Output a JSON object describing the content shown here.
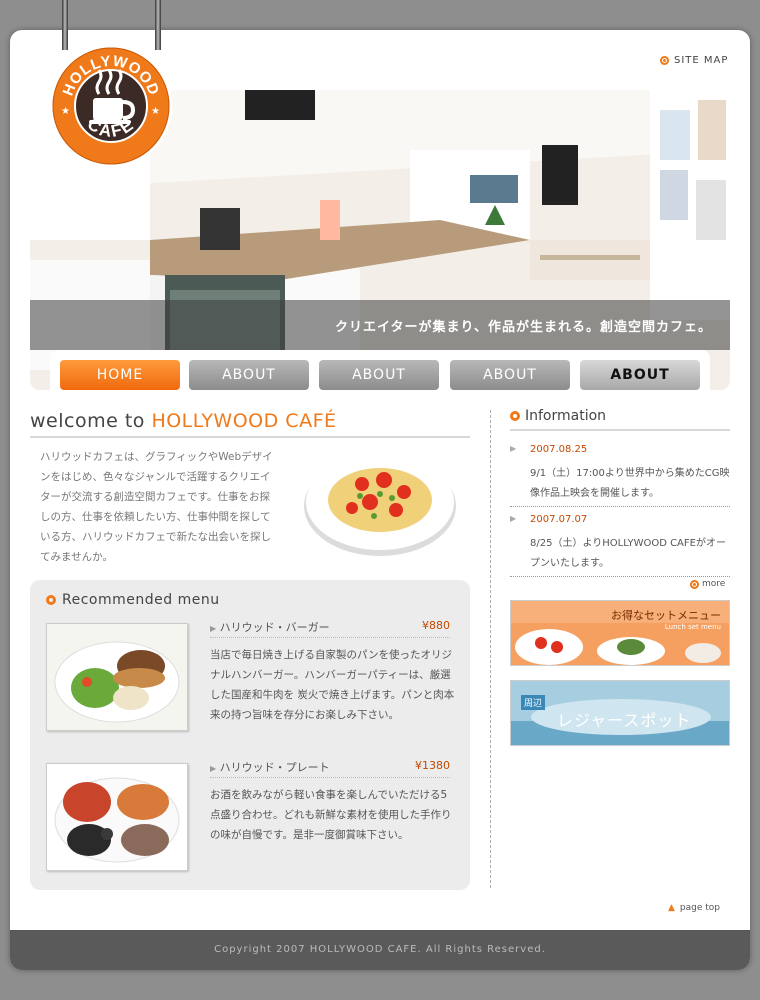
{
  "header": {
    "logo_text_top": "HOLLYWOOD",
    "logo_text_bottom": "CAFE",
    "site_map_label": "SITE MAP"
  },
  "hero": {
    "tagline": "クリエイターが集まり、作品が生まれる。創造空間カフェ。"
  },
  "nav": {
    "items": [
      {
        "label": "HOME"
      },
      {
        "label": "ABOUT"
      },
      {
        "label": "ABOUT"
      },
      {
        "label": "ABOUT"
      },
      {
        "label": "ABOUT"
      }
    ]
  },
  "welcome": {
    "title_prefix": "welcome to ",
    "title_brand": "HOLLYWOOD CAFÉ",
    "text": "ハリウッドカフェは、グラフィックやWebデザインをはじめ、色々なジャンルで活躍するクリエイターが交流する創造空間カフェです。仕事をお探しの方、仕事を依頼したい方、仕事仲間を探している方、ハリウッドカフェで新たな出会いを探してみませんか。"
  },
  "menu": {
    "heading": "Recommended menu",
    "items": [
      {
        "name": "ハリウッド・バーガー",
        "price": "¥880",
        "desc": "当店で毎日焼き上げる自家製のパンを使ったオリジナルハンバーガー。ハンバーガーパティーは、厳選した国産和牛肉を 炭火で焼き上げます。パンと肉本来の持つ旨味を存分にお楽しみ下さい。"
      },
      {
        "name": "ハリウッド・プレート",
        "price": "¥1380",
        "desc": "お酒を飲みながら軽い食事を楽しんでいただける5点盛り合わせ。どれも新鮮な素材を使用した手作りの味が自慢です。是非一度御賞味下さい。"
      }
    ]
  },
  "info": {
    "heading": "Information",
    "news": [
      {
        "date": "2007.08.25",
        "text": "9/1（土）17:00より世界中から集めたCG映像作品上映会を開催します。"
      },
      {
        "date": "2007.07.07",
        "text": "8/25（土）よりHOLLYWOOD CAFEがオープンいたします。"
      }
    ],
    "more_label": "more"
  },
  "banners": {
    "set_menu_title": "お得なセットメニュー",
    "set_menu_sub": "Lunch set menu",
    "leisure_tag": "周辺",
    "leisure_title": "レジャースポット"
  },
  "page_top_label": "page top",
  "footer": {
    "copyright": "Copyright 2007 HOLLYWOOD CAFE. All Rights Reserved."
  },
  "colors": {
    "accent": "#f07a1a",
    "price": "#c04a00",
    "background": "#8e8e8e",
    "footer": "#5a5a5a"
  }
}
